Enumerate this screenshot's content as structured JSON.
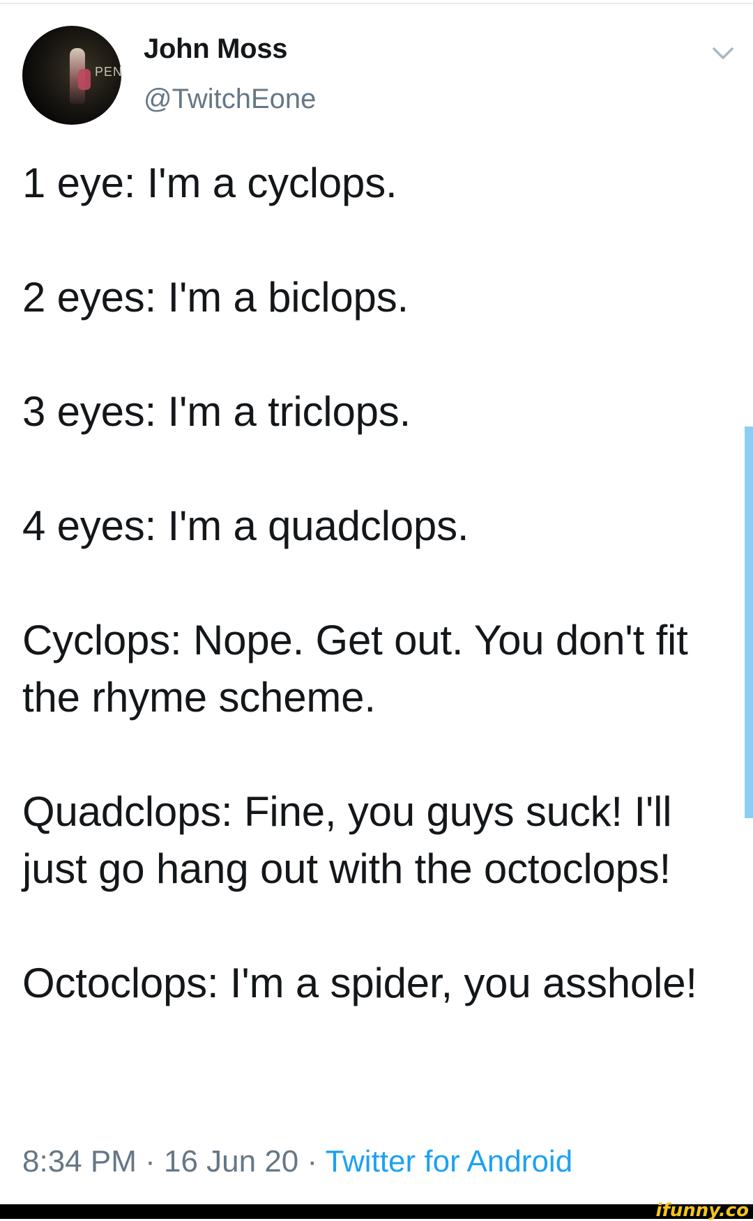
{
  "author": {
    "display_name": "John Moss",
    "handle": "@TwitchEone",
    "avatar_sign": "PENN"
  },
  "tweet": {
    "paragraphs": [
      "1 eye: I'm a cyclops.",
      "2 eyes: I'm a biclops.",
      "3 eyes: I'm a triclops.",
      "4 eyes: I'm a quadclops.",
      "Cyclops: Nope. Get out. You don't fit the rhyme scheme.",
      "Quadclops: Fine, you guys suck! I'll just go hang out with the octoclops!",
      "Octoclops: I'm a spider, you asshole!"
    ],
    "time": "8:34 PM",
    "separator": " · ",
    "date": "16 Jun 20",
    "source": "Twitter for Android"
  },
  "watermark": "ifunny.co",
  "colors": {
    "text": "#14171a",
    "secondary": "#657786",
    "link": "#1da1f2",
    "scrollbar": "#8ecdf3",
    "watermark": "#f5c518"
  },
  "icons": {
    "menu": "chevron-down-icon"
  }
}
